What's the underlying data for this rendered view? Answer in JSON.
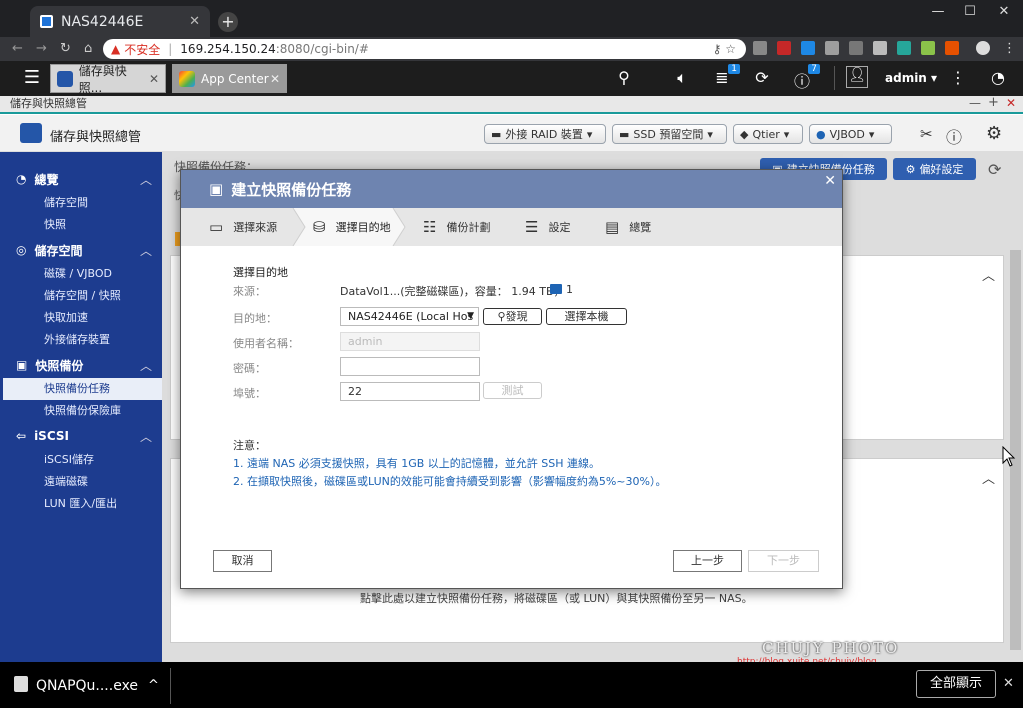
{
  "browser": {
    "tab_title": "NAS42446E",
    "tab_close": "✕",
    "new_tab": "+",
    "insecure_label": "不安全",
    "url_host": "169.254.150.24",
    "url_rest": ":8080/cgi-bin/#",
    "window_controls": [
      "—",
      "☐",
      "✕"
    ]
  },
  "qnap_bar": {
    "tabs": [
      {
        "label": "儲存與快照...",
        "close": "✕"
      },
      {
        "label": "App Center",
        "close": "✕"
      }
    ],
    "user": "admin ▾",
    "badges": {
      "tasks": "1",
      "info": "7"
    }
  },
  "app_window_title": "儲存與快照總管",
  "app_window_controls": [
    "—",
    "+",
    "✕"
  ],
  "app_title": "儲存與快照總管",
  "header_buttons": [
    {
      "label": "外接 RAID 裝置"
    },
    {
      "label": "SSD 預留空間"
    },
    {
      "label": "Qtier"
    },
    {
      "label": "VJBOD"
    }
  ],
  "sidebar": {
    "sections": [
      {
        "title": "總覽",
        "items": [
          "儲存空間",
          "快照"
        ]
      },
      {
        "title": "儲存空間",
        "items": [
          "磁碟 / VJBOD",
          "儲存空間 / 快照",
          "快取加速",
          "外接儲存裝置"
        ]
      },
      {
        "title": "快照備份",
        "items": [
          "快照備份任務",
          "快照備份保險庫"
        ]
      },
      {
        "title": "iSCSI",
        "items": [
          "iSCSI儲存",
          "遠端磁碟",
          "LUN 匯入/匯出"
        ]
      }
    ],
    "selected": "快照備份任務"
  },
  "main": {
    "page_title": "快照備份任務：",
    "create_task_button": "建立快照備份任務",
    "preferences_button": "偏好設定",
    "bg_hint": "點擊此處以建立快照備份任務，將磁碟區（或 LUN）與其快照備份至另一 NAS。",
    "bg_tab_char": "快"
  },
  "modal": {
    "title": "建立快照備份任務",
    "close": "✕",
    "steps": [
      "選擇來源",
      "選擇目的地",
      "備份計劃",
      "設定",
      "總覽"
    ],
    "section_title": "選擇目的地",
    "source_label": "來源：",
    "source_value": "DataVol1...(完整磁碟區)，容量： 1.94 TB，",
    "source_snap_count": "1",
    "dest_label": "目的地：",
    "dest_value": "NAS42446E (Local Hos",
    "discover_button": "發現",
    "select_local_button": "選擇本機",
    "username_label": "使用者名稱：",
    "username_placeholder": "admin",
    "password_label": "密碼：",
    "password_value": "",
    "port_label": "埠號：",
    "port_value": "22",
    "test_button": "測試",
    "notes_title": "注意：",
    "notes": [
      "1. 遠端 NAS 必須支援快照，具有 1GB 以上的記憶體，並允許 SSH 連線。",
      "2. 在擷取快照後，磁碟區或LUN的效能可能會持續受到影響（影響幅度約為5%~30%）。"
    ],
    "cancel_button": "取消",
    "prev_button": "上一步",
    "next_button": "下一步"
  },
  "watermark": {
    "title": "CHUJY PHOTO",
    "url": "http://blog.xuite.net/chujy/blog"
  },
  "taskbar": {
    "download_name": "QNAPQu....exe",
    "download_chevron": "^",
    "show_all": "全部顯示",
    "close": "✕"
  }
}
